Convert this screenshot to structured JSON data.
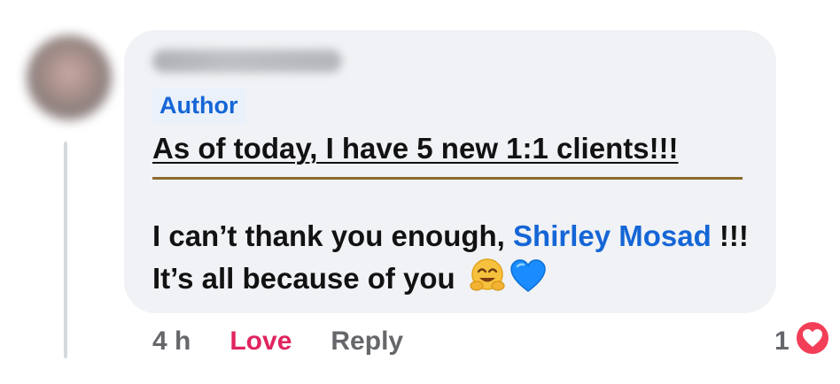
{
  "comment": {
    "author_badge": "Author",
    "headline": "As of today, I have 5 new 1:1 clients!!!",
    "message_before": "I can’t thank you enough, ",
    "mention": "Shirley Mosad",
    "message_after": " !!! It’s all because of you",
    "emojis": [
      "hugging-face-emoji",
      "blue-heart-emoji"
    ]
  },
  "actions": {
    "timestamp": "4 h",
    "love_label": "Love",
    "reply_label": "Reply"
  },
  "reactions": {
    "count": "1",
    "icon": "love-reaction-icon"
  },
  "colors": {
    "bubble": "#f0f2f5",
    "link_blue": "#1566d6",
    "love_red": "#e0245e",
    "muted_gray": "#65676b",
    "underline_gold": "#8b6b2e"
  }
}
